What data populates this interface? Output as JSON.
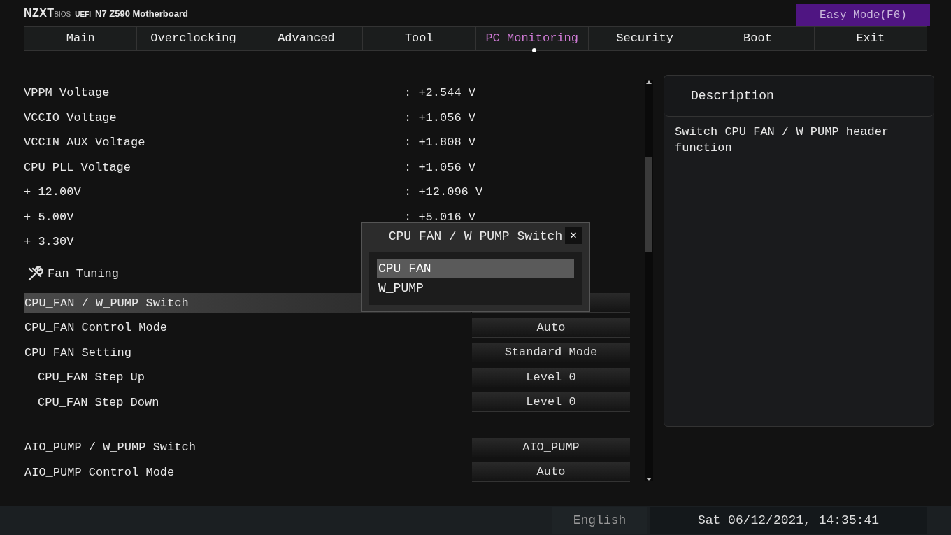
{
  "header": {
    "brand": "NZXT",
    "brand_sub": "BIOS",
    "uefi": "UEFI",
    "board": "N7 Z590 Motherboard",
    "easy_mode_button": "Easy Mode(F6)"
  },
  "tabs": [
    {
      "label": "Main",
      "selected": false
    },
    {
      "label": "Overclocking",
      "selected": false
    },
    {
      "label": "Advanced",
      "selected": false
    },
    {
      "label": "Tool",
      "selected": false
    },
    {
      "label": "PC Monitoring",
      "selected": true
    },
    {
      "label": "Security",
      "selected": false
    },
    {
      "label": "Boot",
      "selected": false
    },
    {
      "label": "Exit",
      "selected": false
    }
  ],
  "rows": [
    {
      "kind": "reading",
      "label": "VPPM Voltage",
      "value": ": +2.544 V"
    },
    {
      "kind": "reading",
      "label": "VCCIO Voltage",
      "value": ": +1.056 V"
    },
    {
      "kind": "reading",
      "label": "VCCIN AUX Voltage",
      "value": ": +1.808 V"
    },
    {
      "kind": "reading",
      "label": "CPU PLL Voltage",
      "value": ": +1.056 V"
    },
    {
      "kind": "reading",
      "label": "+ 12.00V",
      "value": ": +12.096 V"
    },
    {
      "kind": "reading",
      "label": "+ 5.00V",
      "value": ": +5.016 V"
    },
    {
      "kind": "reading",
      "label": "+ 3.30V"
    },
    {
      "kind": "section",
      "label": "Fan Tuning"
    },
    {
      "kind": "setting",
      "label": "CPU_FAN / W_PUMP Switch",
      "selected": true
    },
    {
      "kind": "setting",
      "label": "CPU_FAN Control Mode",
      "value": "Auto",
      "selected": false
    },
    {
      "kind": "setting",
      "label": "CPU_FAN Setting",
      "value": "Standard Mode",
      "selected": false
    },
    {
      "kind": "subsetting",
      "label": "CPU_FAN Step Up",
      "value": "Level 0",
      "selected": false
    },
    {
      "kind": "subsetting",
      "label": "CPU_FAN Step Down",
      "value": "Level 0",
      "selected": false
    },
    {
      "kind": "divider"
    },
    {
      "kind": "setting",
      "label": "AIO_PUMP / W_PUMP Switch",
      "value": "AIO_PUMP",
      "selected": false
    },
    {
      "kind": "setting",
      "label": "AIO_PUMP Control Mode",
      "value": "Auto",
      "selected": false
    }
  ],
  "popup": {
    "title": "CPU_FAN / W_PUMP Switch",
    "close": "✕",
    "options": [
      {
        "label": "CPU_FAN",
        "selected": true
      },
      {
        "label": "W_PUMP",
        "selected": false
      }
    ]
  },
  "description": {
    "title": "Description",
    "text": "Switch CPU_FAN / W_PUMP header function"
  },
  "status_bar": {
    "language": "English",
    "datetime": "Sat 06/12/2021, 14:35:41"
  }
}
